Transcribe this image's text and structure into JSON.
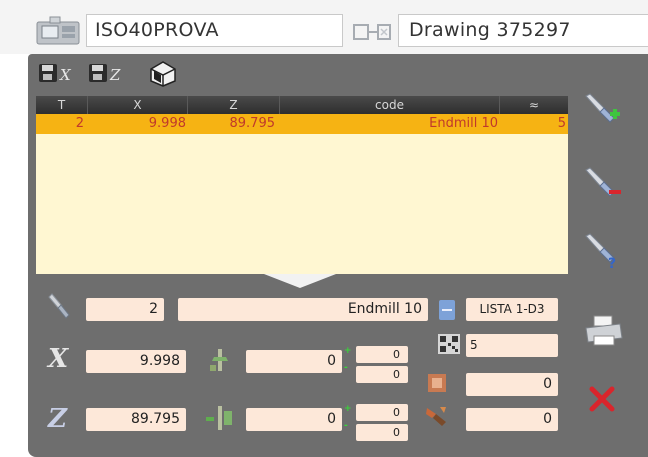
{
  "header": {
    "program_name": "ISO40PROVA",
    "program_dropdown_glyph": "∨",
    "drawing_label": "Drawing 375297"
  },
  "icons": {
    "machine": "machine-icon",
    "drawing": "drawing-link-icon",
    "save_x": "save-x-icon",
    "save_z": "save-z-icon",
    "tool_box": "tool-box-icon",
    "add_tool": "add-tool-icon",
    "remove_tool": "remove-tool-icon",
    "edit_tool": "edit-tool-icon",
    "print": "printer-icon",
    "close": "close-icon"
  },
  "toolbar": {
    "save_x_glyph": "X",
    "save_z_glyph": "Z"
  },
  "table": {
    "columns": [
      "T",
      "X",
      "Z",
      "code",
      "≈"
    ],
    "rows": [
      {
        "t": "2",
        "x": "9.998",
        "z": "89.795",
        "code": "Endmill 10",
        "count": "5"
      }
    ]
  },
  "detail": {
    "tool_number": "2",
    "tool_name": "Endmill 10",
    "list_name": "LISTA 1-D3",
    "life_count": "5",
    "x_label": "X",
    "z_label": "Z",
    "x_value": "9.998",
    "z_value": "89.795",
    "x_offset": "0",
    "z_offset": "0",
    "x_tol_plus": "0",
    "x_tol_minus": "0",
    "z_tol_plus": "0",
    "z_tol_minus": "0",
    "right_value_1": "0",
    "right_value_2": "0",
    "plus_glyph": "+",
    "minus_glyph": "-"
  },
  "colors": {
    "panel_bg": "#6e6e6e",
    "header_bg": "#333333",
    "selected_row": "#f6b313",
    "row_text": "#c0392b",
    "table_body": "#fff7d2",
    "field_bg": "#fde8d9",
    "accent_green": "#3aa637",
    "close_red": "#d9252c"
  }
}
